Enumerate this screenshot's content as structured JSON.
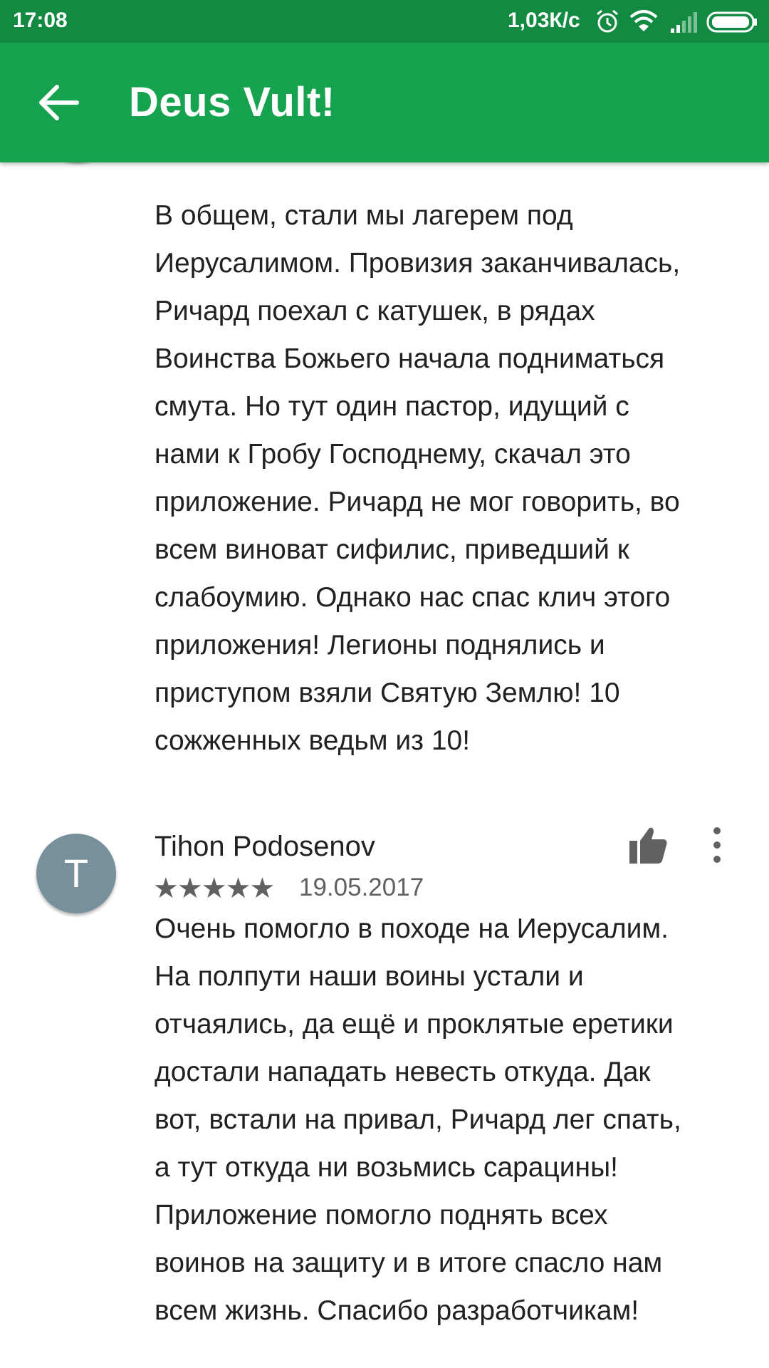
{
  "status_bar": {
    "time": "17:08",
    "network_speed": "1,03К/с",
    "icons": [
      "alarm-icon",
      "wifi-icon",
      "signal-icon",
      "battery-icon"
    ]
  },
  "app_bar": {
    "title": "Deus Vult!",
    "back_icon": "arrow-back-icon",
    "color": "#16a34f"
  },
  "reviews": [
    {
      "text": "В общем, стали мы лагерем под\nИерусалимом. Провизия заканчивалась,\nРичард поехал с катушек, в рядах\nВоинства Божьего начала подниматься\nсмута. Но тут один пастор, идущий с\nнами к Гробу Господнему, скачал это\nприложение. Ричард не мог говорить, во\nвсем виноват сифилис, приведший к\nслабоумию. Однако нас спас клич этого\nприложения! Легионы поднялись и\nприступом взяли Святую Землю! 10\nсожженных ведьм из 10!"
    },
    {
      "avatar_letter": "T",
      "author": "Tihon Podosenov",
      "rating": 5,
      "stars": "★★★★★",
      "date": "19.05.2017",
      "text": "Очень помогло в походе на Иерусалим.\nНа полпути наши воины устали и\nотчаялись, да ещё и проклятые еретики\nдостали нападать невесть откуда. Дак\nвот, встали на привал, Ричард лег спать,\nа тут откуда ни возьмись сарацины!\nПриложение помогло поднять всех\nвоинов на защиту и в итоге спасло нам\nвсем жизнь. Спасибо разработчикам!"
    }
  ]
}
